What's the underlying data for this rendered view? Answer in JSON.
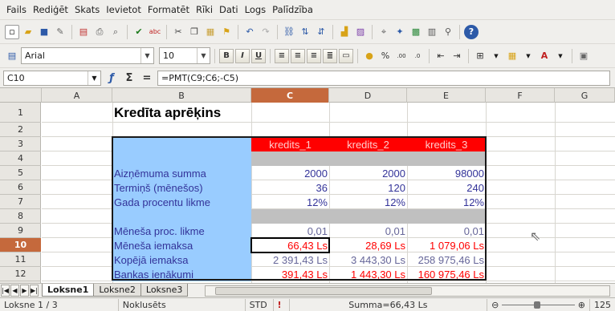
{
  "menu": [
    "Fails",
    "Rediģēt",
    "Skats",
    "Ievietot",
    "Formatēt",
    "Rīki",
    "Dati",
    "Logs",
    "Palīdzība"
  ],
  "toolbar2": {
    "font": "Arial",
    "size": "10"
  },
  "formula_bar": {
    "cell_ref": "C10",
    "formula": "=PMT(C9;C6;-C5)"
  },
  "columns": [
    "A",
    "B",
    "C",
    "D",
    "E",
    "F",
    "G"
  ],
  "rows": [
    "1",
    "2",
    "3",
    "4",
    "5",
    "6",
    "7",
    "8",
    "9",
    "10",
    "11",
    "12"
  ],
  "sheet": {
    "title": "Kredīta aprēķins",
    "headers": [
      "kredits_1",
      "kredits_2",
      "kredits_3"
    ],
    "labels": {
      "r5": "Aizņēmuma summa",
      "r6": "Termiņš (mēnešos)",
      "r7": "Gada procentu likme",
      "r9": "Mēneša proc. likme",
      "r10": "Mēneša iemaksa",
      "r11": "Kopējā iemaksa",
      "r12": "Bankas ienākumi"
    },
    "values": {
      "r5": [
        "2000",
        "2000",
        "98000"
      ],
      "r6": [
        "36",
        "120",
        "240"
      ],
      "r7": [
        "12%",
        "12%",
        "12%"
      ],
      "r9": [
        "0,01",
        "0,01",
        "0,01"
      ],
      "r10": [
        "66,43 Ls",
        "28,69 Ls",
        "1 079,06 Ls"
      ],
      "r11": [
        "2 391,43 Ls",
        "3 443,30 Ls",
        "258 975,46 Ls"
      ],
      "r12": [
        "391,43 Ls",
        "1 443,30 Ls",
        "160 975,46 Ls"
      ]
    }
  },
  "tabs": [
    "Loksne1",
    "Loksne2",
    "Loksne3"
  ],
  "status": {
    "sheet": "Loksne 1 / 3",
    "style": "Noklusēts",
    "mode": "STD",
    "sum": "Summa=66,43 Ls",
    "zoom": "125"
  },
  "colors": {
    "selected_header": "#c5693c",
    "table_blue": "#99ccff",
    "header_red": "#ff0000",
    "separator_grey": "#c0c0c0",
    "label_text": "#333399"
  }
}
